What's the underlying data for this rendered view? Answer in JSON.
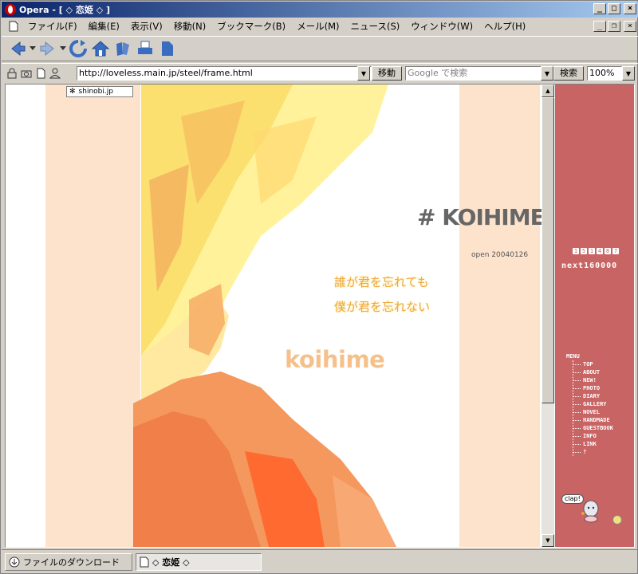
{
  "window": {
    "title": "Opera - [ ◇ 恋姫 ◇ ]",
    "buttons": {
      "minimize": "_",
      "maximize": "□",
      "close": "×",
      "restore": "❐"
    }
  },
  "menubar": {
    "items": [
      "ファイル(F)",
      "編集(E)",
      "表示(V)",
      "移動(N)",
      "ブックマーク(B)",
      "メール(M)",
      "ニュース(S)",
      "ウィンドウ(W)",
      "ヘルプ(H)"
    ]
  },
  "toolbar": {
    "icons": [
      "back-icon",
      "history-dropdown-icon",
      "forward-icon",
      "forward-dropdown-icon",
      "reload-icon",
      "home-icon",
      "hotlist-icon",
      "print-icon",
      "document-icon"
    ]
  },
  "addressbar": {
    "url": "http://loveless.main.jp/steel/frame.html",
    "go_label": "移動",
    "search_placeholder": "Google で検索",
    "search_label": "検索",
    "zoom": "100%"
  },
  "page": {
    "badge": "shinobi.jp",
    "site_title": "# KOIHIME",
    "open_date": "open 20040126",
    "poem_line1": "誰が君を忘れても",
    "poem_line2": "僕が君を忘れない",
    "logo_text": "koihime"
  },
  "sidebar": {
    "counter_digits": [
      "1",
      "5",
      "1",
      "4",
      "8",
      "7"
    ],
    "next_label": "next160000",
    "menu_title": "MENU",
    "menu_items": [
      "TOP",
      "ABOUT",
      "NEW!",
      "PHOTO",
      "DIARY",
      "GALLERY",
      "NOVEL",
      "HANDMADE",
      "GUESTBOOK",
      "INFO",
      "LINK",
      "?"
    ],
    "clap_label": "clap!"
  },
  "statusbar": {
    "download_label": "ファイルのダウンロード",
    "active_tab_label": "◇ 恋姫 ◇"
  },
  "colors": {
    "titlebar_start": "#0a246a",
    "peach": "#fde3cc",
    "sidebar": "#c86464",
    "title_gray": "#666666",
    "poem_orange": "#f0a840"
  }
}
